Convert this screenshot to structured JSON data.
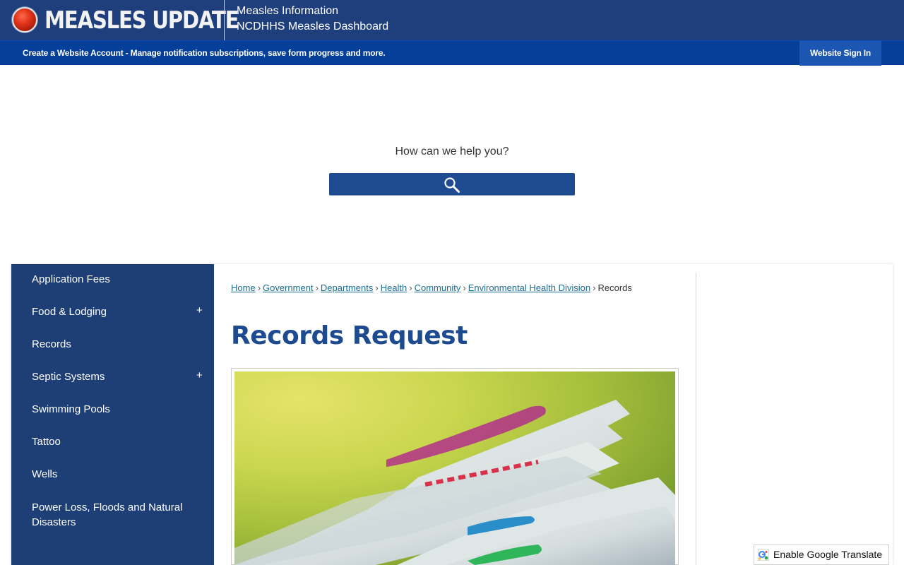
{
  "alert": {
    "title": "MEASLES UPDATE",
    "links": [
      "Measles Information",
      "NCDHHS Measles Dashboard"
    ]
  },
  "account_bar": {
    "create_link": "Create a Website Account",
    "description": " - Manage notification subscriptions, save form progress and more.",
    "sign_in": "Website Sign In"
  },
  "search": {
    "label": "How can we help you?",
    "icon": "search-icon"
  },
  "sidebar": {
    "items": [
      {
        "label": "Application Fees",
        "expandable": false
      },
      {
        "label": "Food & Lodging",
        "expandable": true
      },
      {
        "label": "Records",
        "expandable": false
      },
      {
        "label": "Septic Systems",
        "expandable": true
      },
      {
        "label": "Swimming Pools",
        "expandable": false
      },
      {
        "label": "Tattoo",
        "expandable": false
      },
      {
        "label": "Wells",
        "expandable": false
      },
      {
        "label": "Power Loss, Floods and Natural Disasters",
        "expandable": false
      }
    ],
    "expand_glyph": "+"
  },
  "breadcrumb": {
    "links": [
      "Home",
      "Government",
      "Departments",
      "Health",
      "Community",
      "Environmental Health Division"
    ],
    "current": "Records",
    "separator": "›"
  },
  "page": {
    "title": "Records Request"
  },
  "translate": {
    "label": "Enable Google Translate"
  },
  "colors": {
    "header_navy": "#1e3f7b",
    "account_blue": "#063f9a",
    "sidebar_navy": "#1e3f75",
    "title_blue": "#1e4a8f",
    "link_teal": "#1f6d8f"
  }
}
